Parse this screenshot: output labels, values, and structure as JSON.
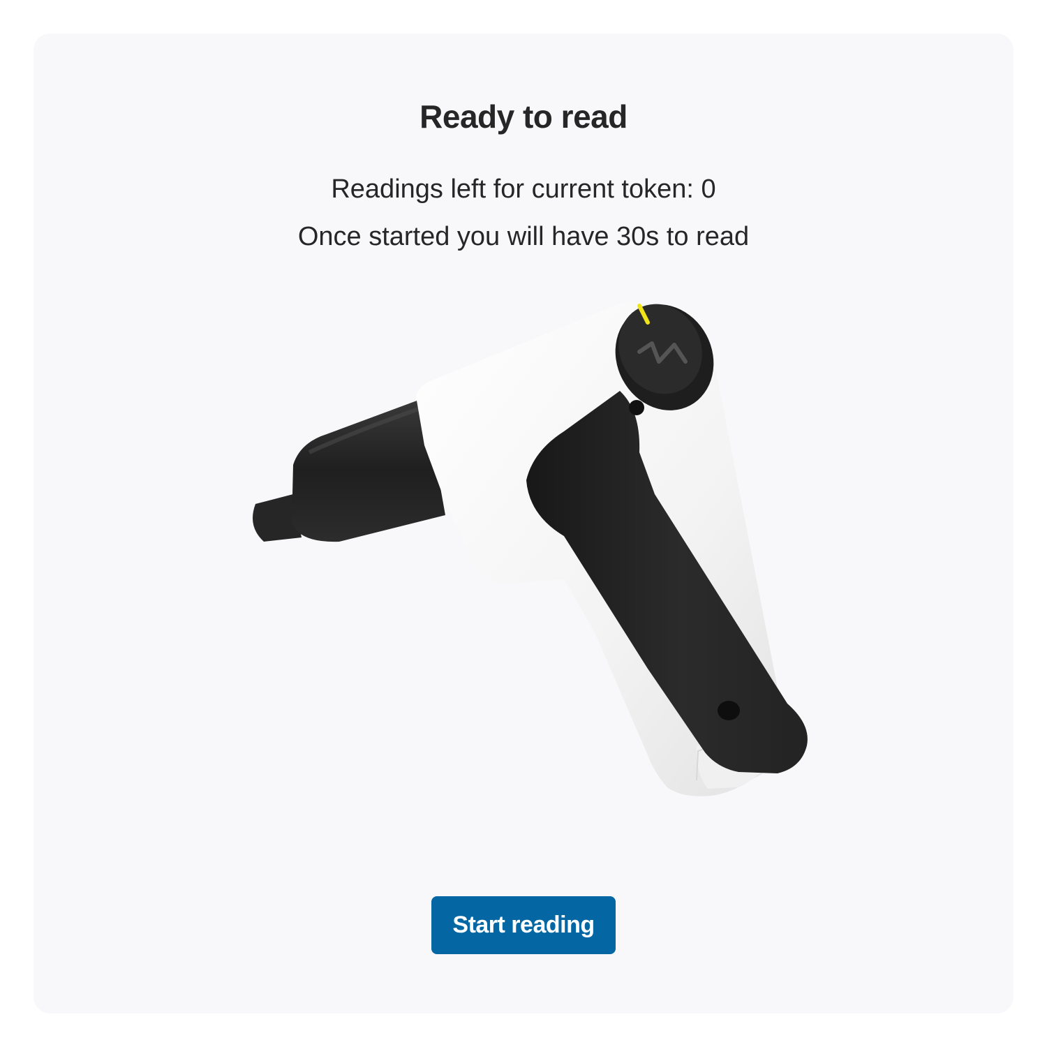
{
  "title": "Ready to read",
  "info": {
    "readings_left": "Readings left for current token: 0",
    "time_limit": "Once started you will have 30s to read"
  },
  "device_image": {
    "icon": "handheld-reader-device"
  },
  "actions": {
    "start_label": "Start reading"
  },
  "colors": {
    "accent": "#0467a4",
    "card_background": "#f8f8fa",
    "text": "#262626",
    "indicator": "#f1e31a"
  }
}
